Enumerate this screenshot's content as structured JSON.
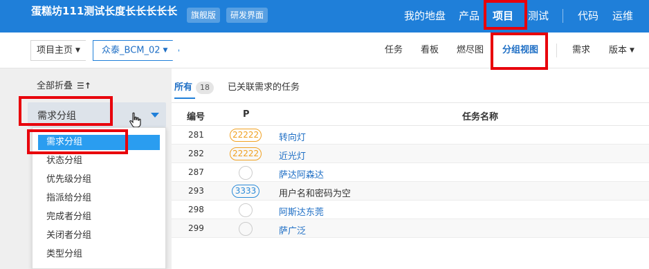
{
  "topbar": {
    "title": "蛋糕坊111测试长度长长长长长",
    "badge_edition": "旗舰版",
    "badge_mode": "研发界面",
    "nav": [
      "我的地盘",
      "产品",
      "项目",
      "测试",
      "代码",
      "运维"
    ],
    "active_nav": "项目",
    "bg_color": "#1f7fd9"
  },
  "subbar": {
    "home_label": "项目主页",
    "project_label": "众泰_BCM_02",
    "nav": [
      "任务",
      "看板",
      "燃尽图",
      "分组视图",
      "需求",
      "版本"
    ],
    "active_nav": "分组视图"
  },
  "left": {
    "collapse_label": "全部折叠",
    "group_select_value": "需求分组",
    "dropdown_options": [
      "需求分组",
      "状态分组",
      "优先级分组",
      "指派给分组",
      "完成者分组",
      "关闭者分组",
      "类型分组"
    ],
    "selected_option": "需求分组"
  },
  "content": {
    "tab_all": "所有",
    "tab_all_count": "18",
    "tab_linked": "已关联需求的任务",
    "columns": [
      "编号",
      "P",
      "任务名称"
    ],
    "rows": [
      {
        "id": "281",
        "pri": "22222",
        "pri_color": "#f0a020",
        "name": "转向灯"
      },
      {
        "id": "282",
        "pri": "22222",
        "pri_color": "#f0a020",
        "name": "近光灯"
      },
      {
        "id": "287",
        "pri": "",
        "pri_color": "",
        "name": "萨达阿森达"
      },
      {
        "id": "293",
        "pri": "3333",
        "pri_color": "#2a8ad8",
        "name": "用户名和密码为空"
      },
      {
        "id": "298",
        "pri": "",
        "pri_color": "",
        "name": "阿斯达东莞"
      },
      {
        "id": "299",
        "pri": "",
        "pri_color": "",
        "name": "萨广泛"
      }
    ]
  },
  "highlight_color": "#e8000b"
}
